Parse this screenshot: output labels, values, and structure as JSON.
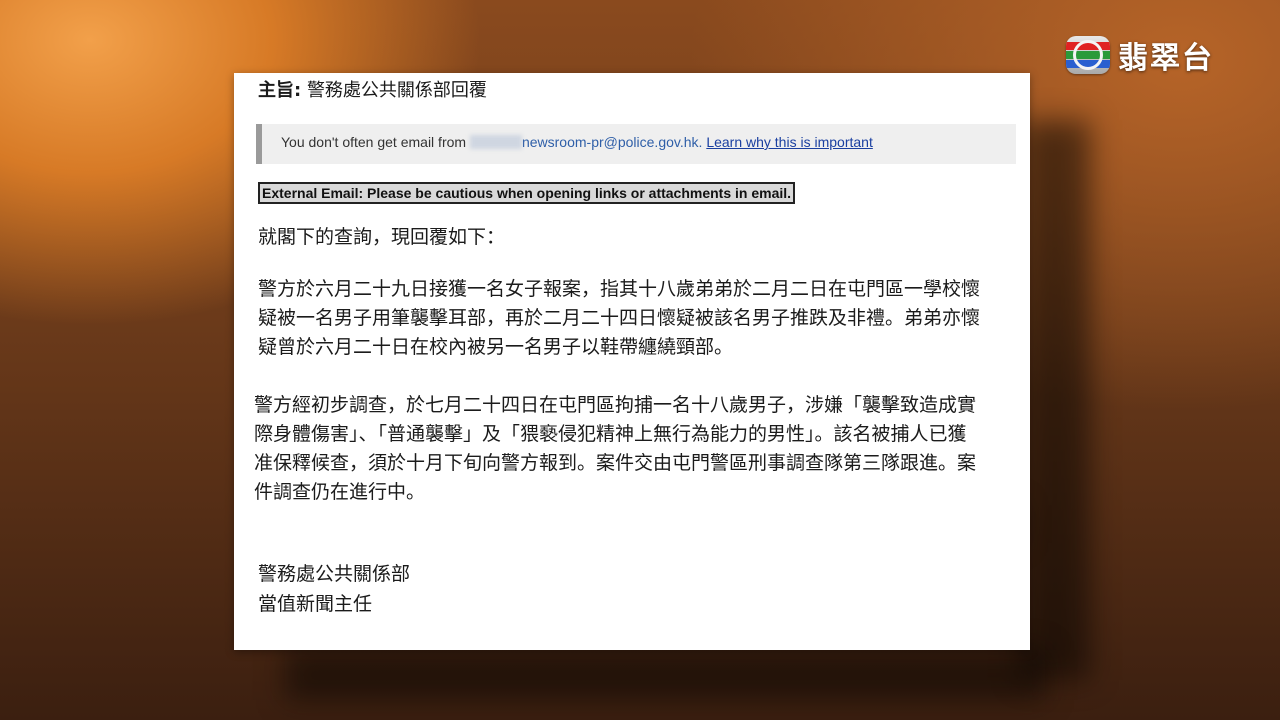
{
  "broadcaster": {
    "logo_icon": "tvb-logo-icon",
    "name": "翡翠台"
  },
  "email": {
    "subject_label": "主旨:",
    "subject": "警務處公共關係部回覆",
    "notice": {
      "prefix": "You don't often get email from",
      "sender": "newsroom-pr@police.gov.hk.",
      "link": "Learn why this is important"
    },
    "external_warning": "External Email: Please be cautious when opening links or attachments in email.",
    "greeting": "就閣下的查詢，現回覆如下：",
    "paragraph_1": [
      "警方於六月二十九日接獲一名女子報案，指其十八歲弟弟於二月二日在屯門區一學校懷",
      "疑被一名男子用筆襲擊耳部，再於二月二十四日懷疑被該名男子推跌及非禮。弟弟亦懷",
      "疑曾於六月二十日在校內被另一名男子以鞋帶纏繞頸部。"
    ],
    "paragraph_2": [
      "警方經初步調查，於七月二十四日在屯門區拘捕一名十八歲男子，涉嫌「襲擊致造成實",
      "際身體傷害」、「普通襲擊」及「猥褻侵犯精神上無行為能力的男性」。該名被捕人已獲",
      "准保釋候查，須於十月下旬向警方報到。案件交由屯門警區刑事調查隊第三隊跟進。案",
      "件調查仍在進行中。"
    ],
    "signature": [
      "警務處公共關係部",
      "當值新聞主任"
    ]
  }
}
